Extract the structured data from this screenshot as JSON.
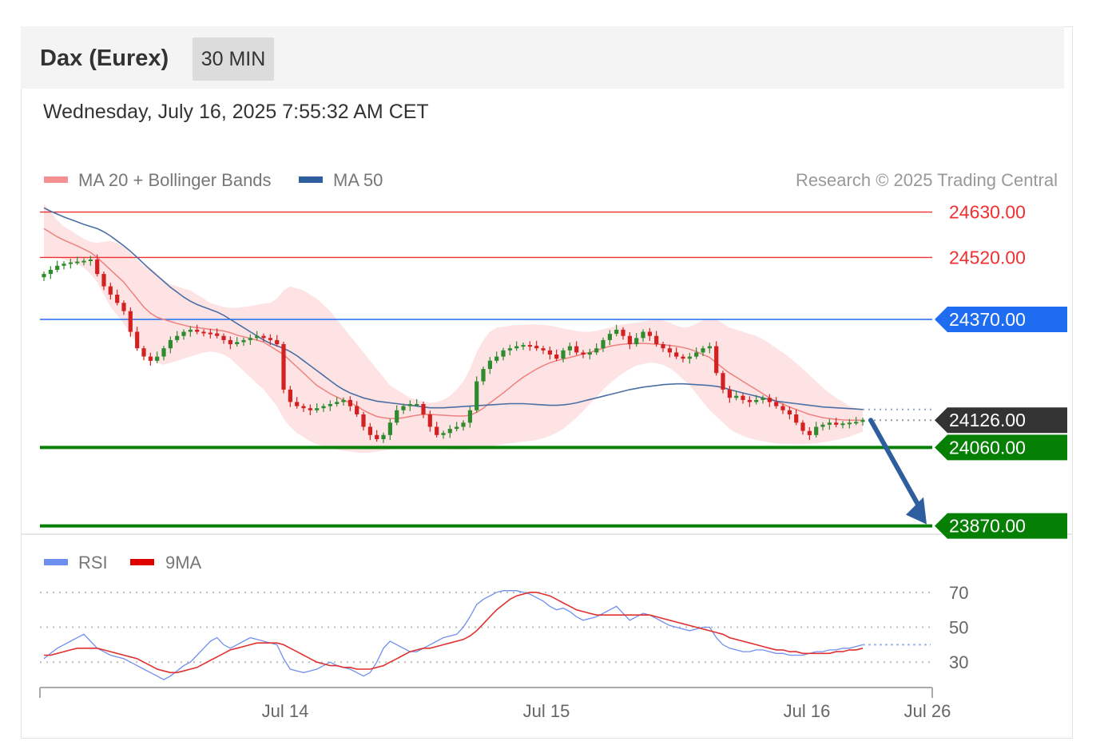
{
  "header": {
    "instrument": "Dax (Eurex)",
    "timeframe": "30 MIN",
    "datetime": "Wednesday, July 16, 2025 7:55:32 AM CET"
  },
  "legend": {
    "ma20_bb": "MA 20 + Bollinger Bands",
    "ma50": "MA 50",
    "credit": "Research © 2025 Trading Central"
  },
  "rsi_legend": {
    "rsi": "RSI",
    "ma9": "9MA"
  },
  "colors": {
    "bb_fill": "#fde0e0",
    "ma20": "#f08080",
    "ma50": "#4a6fa5",
    "resistance": "#f03030",
    "pivot": "#1e6cf0",
    "support": "#058005",
    "last_price": "#333333",
    "bull": "#2e8b2e",
    "bear": "#d32020",
    "rsi": "#6f8ff0",
    "rsi_ma": "#e03030",
    "arrow": "#2e5e9e"
  },
  "chart_data": {
    "type": "candlestick",
    "title": "Dax (Eurex)",
    "timeframe": "30 MIN",
    "y_range": [
      23848,
      24660
    ],
    "price_levels": [
      {
        "value": 24630.0,
        "label": "24630.00",
        "role": "resistance"
      },
      {
        "value": 24520.0,
        "label": "24520.00",
        "role": "resistance"
      },
      {
        "value": 24370.0,
        "label": "24370.00",
        "role": "pivot"
      },
      {
        "value": 24126.0,
        "label": "24126.00",
        "role": "last_price"
      },
      {
        "value": 24060.0,
        "label": "24060.00",
        "role": "support"
      },
      {
        "value": 23870.0,
        "label": "23870.00",
        "role": "support"
      }
    ],
    "x_ticks": [
      "Jul 14",
      "Jul 15",
      "Jul 16",
      "Jul 26"
    ],
    "forecast_arrow": {
      "from": 24126,
      "to": 23870
    },
    "closes": [
      24480,
      24490,
      24500,
      24505,
      24508,
      24510,
      24512,
      24515,
      24480,
      24450,
      24430,
      24410,
      24390,
      24340,
      24300,
      24280,
      24270,
      24280,
      24300,
      24320,
      24330,
      24340,
      24345,
      24340,
      24338,
      24336,
      24330,
      24320,
      24310,
      24315,
      24320,
      24325,
      24330,
      24325,
      24320,
      24310,
      24200,
      24170,
      24160,
      24155,
      24150,
      24155,
      24160,
      24165,
      24170,
      24175,
      24160,
      24140,
      24110,
      24090,
      24080,
      24090,
      24120,
      24150,
      24160,
      24165,
      24165,
      24140,
      24110,
      24090,
      24095,
      24105,
      24110,
      24120,
      24150,
      24220,
      24250,
      24270,
      24280,
      24295,
      24300,
      24305,
      24308,
      24306,
      24300,
      24295,
      24285,
      24275,
      24295,
      24305,
      24290,
      24285,
      24290,
      24300,
      24320,
      24335,
      24345,
      24330,
      24310,
      24325,
      24340,
      24330,
      24310,
      24300,
      24290,
      24280,
      24275,
      24280,
      24290,
      24300,
      24305,
      24240,
      24200,
      24180,
      24185,
      24175,
      24170,
      24175,
      24180,
      24170,
      24160,
      24150,
      24140,
      24120,
      24100,
      24090,
      24110,
      24115,
      24120,
      24115,
      24118,
      24120,
      24122,
      24126
    ],
    "ma20": [
      24590,
      24580,
      24570,
      24562,
      24555,
      24548,
      24540,
      24532,
      24520,
      24505,
      24490,
      24475,
      24460,
      24440,
      24420,
      24400,
      24385,
      24375,
      24370,
      24365,
      24360,
      24356,
      24352,
      24350,
      24348,
      24346,
      24344,
      24342,
      24338,
      24332,
      24328,
      24324,
      24320,
      24315,
      24305,
      24295,
      24285,
      24270,
      24255,
      24240,
      24225,
      24210,
      24200,
      24190,
      24182,
      24175,
      24168,
      24160,
      24150,
      24142,
      24135,
      24132,
      24130,
      24130,
      24132,
      24135,
      24138,
      24140,
      24140,
      24139,
      24138,
      24137,
      24136,
      24136,
      24138,
      24145,
      24155,
      24168,
      24180,
      24192,
      24205,
      24218,
      24230,
      24240,
      24250,
      24258,
      24265,
      24270,
      24274,
      24278,
      24282,
      24286,
      24290,
      24295,
      24300,
      24305,
      24308,
      24310,
      24311,
      24312,
      24312,
      24311,
      24310,
      24309,
      24307,
      24305,
      24302,
      24298,
      24292,
      24285,
      24278,
      24265,
      24252,
      24240,
      24230,
      24220,
      24210,
      24200,
      24190,
      24180,
      24172,
      24165,
      24158,
      24152,
      24146,
      24140,
      24136,
      24132,
      24130,
      24128,
      24127,
      24126,
      24126,
      24126
    ],
    "bb_upper": [
      24650,
      24630,
      24610,
      24595,
      24585,
      24575,
      24565,
      24558,
      24555,
      24558,
      24560,
      24555,
      24545,
      24530,
      24515,
      24500,
      24495,
      24480,
      24465,
      24455,
      24450,
      24445,
      24440,
      24430,
      24420,
      24410,
      24405,
      24400,
      24398,
      24398,
      24400,
      24402,
      24405,
      24408,
      24410,
      24420,
      24440,
      24450,
      24445,
      24440,
      24430,
      24420,
      24405,
      24390,
      24370,
      24350,
      24330,
      24310,
      24290,
      24270,
      24250,
      24230,
      24210,
      24200,
      24190,
      24180,
      24175,
      24170,
      24168,
      24170,
      24175,
      24185,
      24200,
      24220,
      24250,
      24290,
      24320,
      24340,
      24350,
      24352,
      24355,
      24356,
      24357,
      24358,
      24358,
      24357,
      24355,
      24352,
      24348,
      24345,
      24342,
      24340,
      24340,
      24342,
      24346,
      24350,
      24355,
      24358,
      24360,
      24362,
      24365,
      24368,
      24370,
      24368,
      24362,
      24355,
      24350,
      24352,
      24360,
      24368,
      24372,
      24370,
      24360,
      24350,
      24345,
      24340,
      24335,
      24330,
      24322,
      24312,
      24300,
      24290,
      24278,
      24264,
      24250,
      24235,
      24220,
      24205,
      24192,
      24180,
      24170,
      24160,
      24155,
      24150
    ],
    "bb_lower": [
      24520,
      24520,
      24520,
      24515,
      24510,
      24505,
      24495,
      24480,
      24460,
      24430,
      24400,
      24380,
      24360,
      24335,
      24310,
      24290,
      24275,
      24265,
      24260,
      24265,
      24270,
      24275,
      24280,
      24285,
      24290,
      24292,
      24290,
      24285,
      24275,
      24260,
      24245,
      24230,
      24215,
      24200,
      24180,
      24160,
      24130,
      24110,
      24095,
      24085,
      24075,
      24068,
      24062,
      24058,
      24055,
      24052,
      24050,
      24048,
      24047,
      24048,
      24050,
      24052,
      24055,
      24060,
      24062,
      24063,
      24063,
      24062,
      24060,
      24058,
      24056,
      24055,
      24054,
      24054,
      24055,
      24058,
      24060,
      24062,
      24065,
      24068,
      24070,
      24072,
      24074,
      24076,
      24078,
      24082,
      24088,
      24095,
      24105,
      24118,
      24132,
      24148,
      24165,
      24182,
      24200,
      24215,
      24228,
      24240,
      24250,
      24258,
      24262,
      24265,
      24264,
      24260,
      24252,
      24240,
      24225,
      24210,
      24190,
      24170,
      24150,
      24135,
      24120,
      24105,
      24095,
      24088,
      24082,
      24078,
      24075,
      24072,
      24070,
      24069,
      24068,
      24068,
      24068,
      24069,
      24070,
      24072,
      24075,
      24078,
      24082,
      24086,
      24092,
      24098
    ],
    "ma50": [
      24640,
      24632,
      24625,
      24618,
      24612,
      24606,
      24600,
      24595,
      24590,
      24582,
      24572,
      24560,
      24548,
      24535,
      24520,
      24505,
      24490,
      24476,
      24462,
      24448,
      24436,
      24424,
      24414,
      24406,
      24400,
      24394,
      24388,
      24380,
      24370,
      24360,
      24350,
      24340,
      24330,
      24320,
      24312,
      24306,
      24300,
      24292,
      24282,
      24270,
      24258,
      24246,
      24234,
      24222,
      24210,
      24200,
      24192,
      24186,
      24180,
      24176,
      24172,
      24170,
      24168,
      24166,
      24164,
      24162,
      24160,
      24158,
      24156,
      24156,
      24156,
      24157,
      24158,
      24159,
      24160,
      24161,
      24162,
      24163,
      24164,
      24165,
      24166,
      24166,
      24166,
      24165,
      24164,
      24163,
      24162,
      24162,
      24163,
      24165,
      24168,
      24172,
      24176,
      24180,
      24184,
      24188,
      24192,
      24196,
      24200,
      24203,
      24206,
      24208,
      24210,
      24212,
      24213,
      24214,
      24214,
      24213,
      24212,
      24211,
      24210,
      24208,
      24205,
      24200,
      24196,
      24192,
      24188,
      24184,
      24180,
      24176,
      24172,
      24170,
      24168,
      24166,
      24164,
      24162,
      24160,
      24158,
      24157,
      24156,
      24155,
      24154,
      24153,
      24152
    ],
    "rsi_panel": {
      "y_range": [
        15,
        80
      ],
      "levels": [
        70,
        50,
        30
      ],
      "rsi": [
        32,
        35,
        38,
        40,
        42,
        44,
        46,
        42,
        38,
        36,
        34,
        33,
        32,
        30,
        28,
        26,
        24,
        22,
        20,
        22,
        25,
        28,
        30,
        34,
        38,
        42,
        44,
        40,
        38,
        40,
        42,
        44,
        43,
        42,
        41,
        40,
        32,
        26,
        25,
        24,
        25,
        26,
        28,
        30,
        28,
        27,
        26,
        24,
        22,
        24,
        30,
        38,
        42,
        40,
        38,
        36,
        36,
        38,
        40,
        42,
        44,
        45,
        46,
        50,
        56,
        63,
        66,
        68,
        70,
        71,
        71,
        71,
        70,
        69,
        67,
        65,
        62,
        60,
        61,
        59,
        56,
        54,
        55,
        56,
        58,
        60,
        62,
        58,
        54,
        56,
        58,
        57,
        55,
        53,
        51,
        50,
        49,
        48,
        49,
        50,
        50,
        44,
        40,
        38,
        37,
        36,
        36,
        37,
        37,
        36,
        35,
        35,
        34,
        34,
        34,
        35,
        36,
        36,
        37,
        37,
        38,
        38,
        39,
        40
      ],
      "ma9": [
        34,
        34,
        35,
        36,
        37,
        38,
        38,
        38,
        38,
        37,
        36,
        35,
        34,
        33,
        32,
        30,
        28,
        26,
        25,
        24,
        24,
        25,
        26,
        27,
        29,
        31,
        33,
        35,
        37,
        38,
        39,
        40,
        41,
        41,
        41,
        41,
        40,
        38,
        36,
        34,
        32,
        30,
        29,
        28,
        28,
        27,
        27,
        26,
        26,
        26,
        27,
        28,
        30,
        32,
        34,
        36,
        37,
        38,
        38,
        39,
        40,
        41,
        42,
        43,
        45,
        48,
        52,
        56,
        60,
        63,
        66,
        68,
        69,
        70,
        70,
        69,
        68,
        66,
        64,
        62,
        60,
        59,
        58,
        57,
        57,
        57,
        57,
        57,
        57,
        57,
        57,
        57,
        56,
        55,
        54,
        53,
        52,
        51,
        50,
        49,
        48,
        47,
        46,
        44,
        43,
        42,
        41,
        40,
        39,
        38,
        37,
        37,
        36,
        36,
        35,
        35,
        35,
        35,
        35,
        36,
        36,
        37,
        37,
        38
      ]
    }
  }
}
